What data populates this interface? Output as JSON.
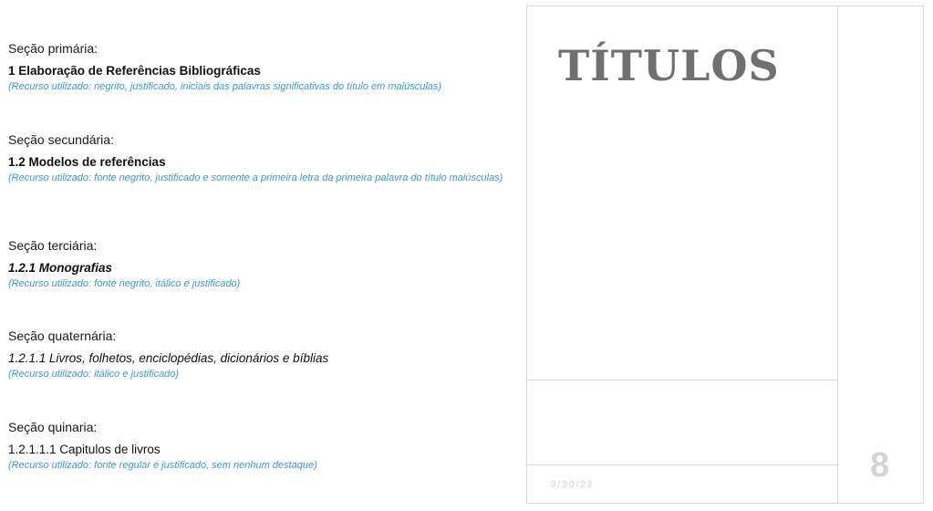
{
  "sections": [
    {
      "label": "Seção primária:",
      "heading": "1 Elaboração de Referências Bibliográficas",
      "note": "(Recurso utilizado: negrito, justificado, iniciais das palavras significativas do título em maiúsculas)"
    },
    {
      "label": "Seção secundária:",
      "heading": "1.2 Modelos de referências",
      "note": "(Recurso utilizado: fonte negrito, justificado e somente a primeira letra da primeira palavra do título maiúsculas)"
    },
    {
      "label": "Seção terciária:",
      "heading": "1.2.1 Monografias",
      "note": "(Recurso utilizado: fonte negrito, itálico e justificado)"
    },
    {
      "label": "Seção quaternária:",
      "heading": "1.2.1.1 Livros, folhetos, enciclopédias, dicionários e bíblias",
      "note": "(Recurso utilizado: itálico e justificado)"
    },
    {
      "label": "Seção quinaria:",
      "heading": "1.2.1.1.1 Capitulos de livros",
      "note": "(Recurso utilizado: fonte regular e justificado, sem nenhum destaque)"
    }
  ],
  "slide": {
    "title": "TÍTULOS",
    "date": "9/30/22",
    "number": "8"
  },
  "colors": {
    "note_text": "#3a9ad9",
    "title_text": "#707070",
    "frame_lines": "#d9d9d9"
  }
}
